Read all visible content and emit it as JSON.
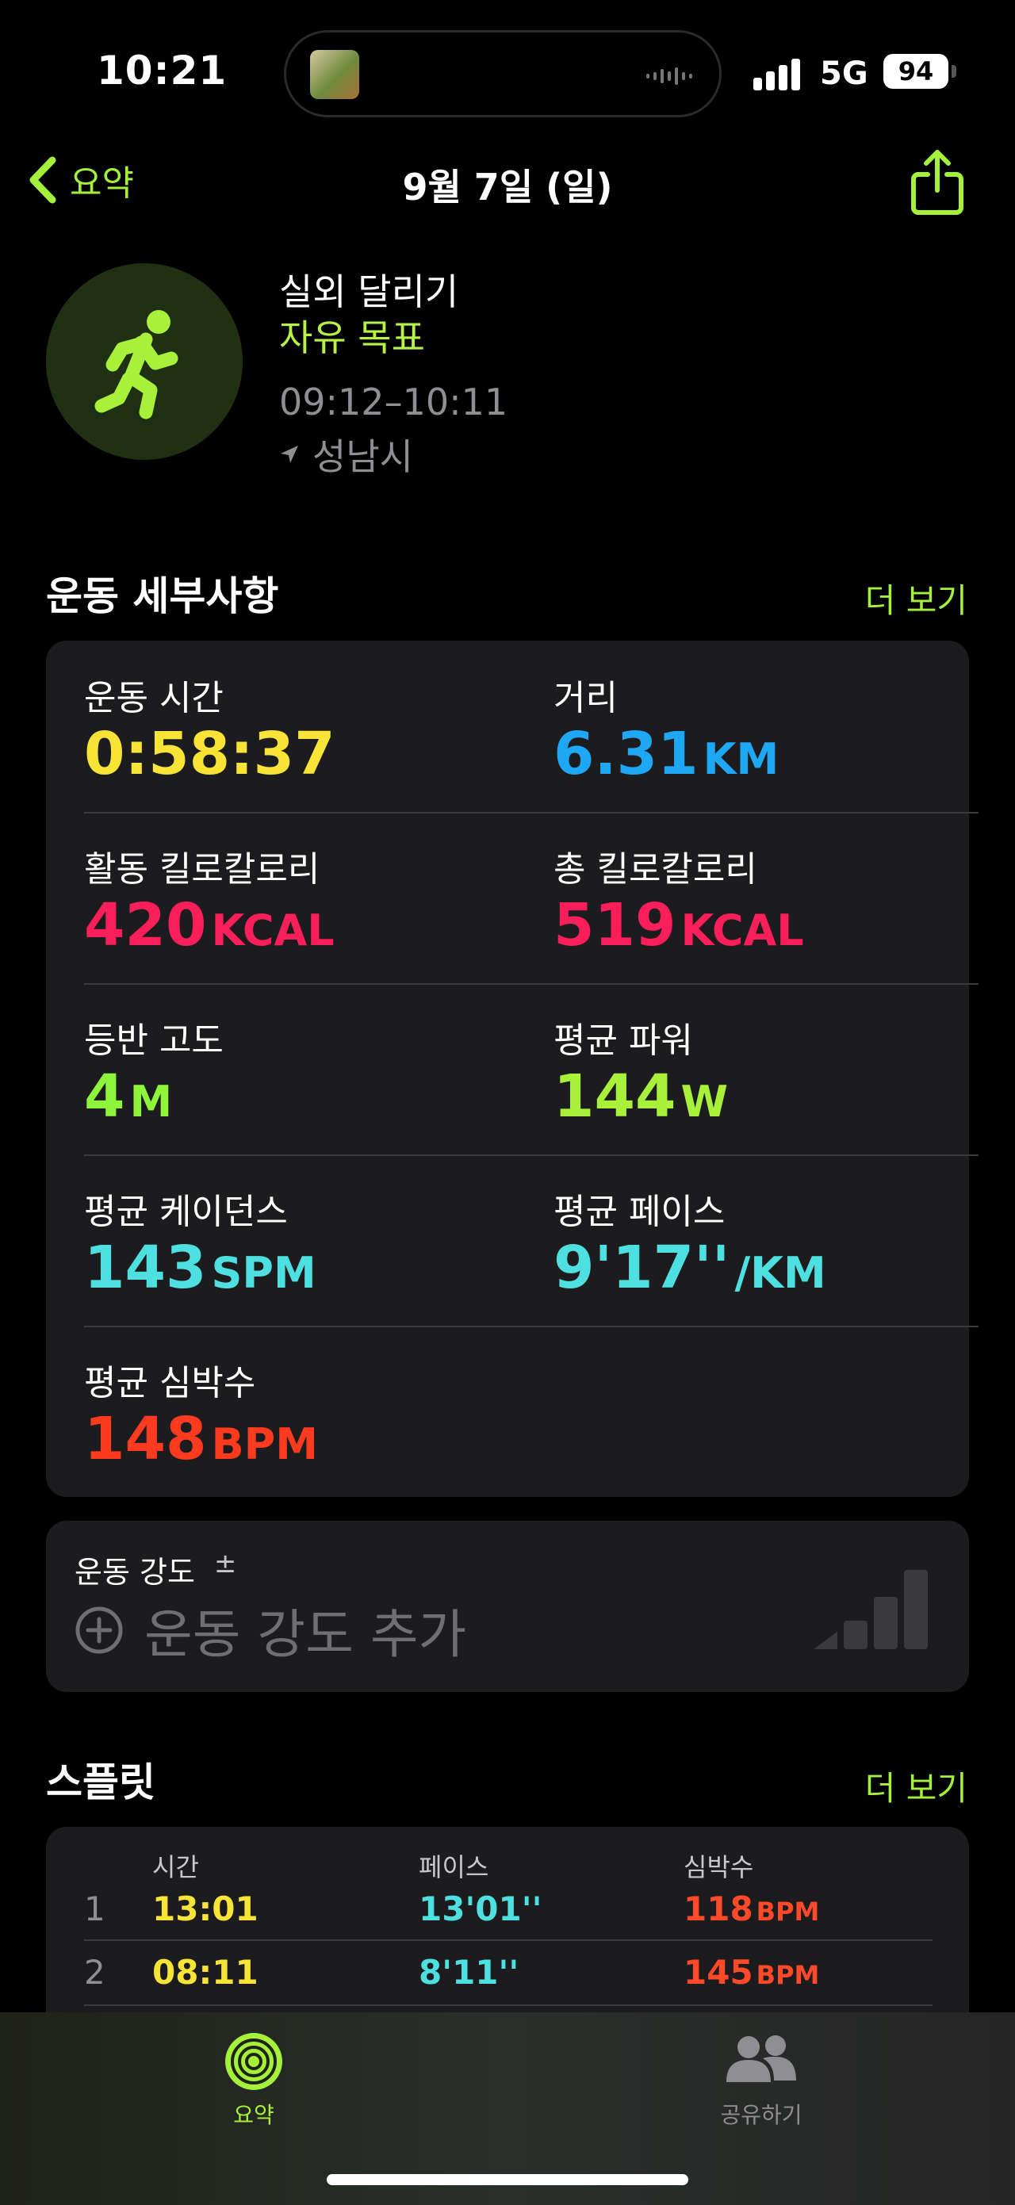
{
  "status_bar": {
    "time": "10:21",
    "network": "5G",
    "battery": "94"
  },
  "nav": {
    "back_label": "요약",
    "title": "9월 7일 (일)"
  },
  "workout": {
    "name": "실외 달리기",
    "goal": "자유 목표",
    "time_range": "09:12–10:11",
    "location": "성남시"
  },
  "details": {
    "title": "운동 세부사항",
    "more": "더 보기",
    "metrics": [
      {
        "label": "운동 시간",
        "value": "0:58:37",
        "unit": "",
        "color": "#f7e437"
      },
      {
        "label": "거리",
        "value": "6.31",
        "unit": "KM",
        "color": "#1ea7f5"
      },
      {
        "label": "활동 킬로칼로리",
        "value": "420",
        "unit": "KCAL",
        "color": "#fa1f5a"
      },
      {
        "label": "총 킬로칼로리",
        "value": "519",
        "unit": "KCAL",
        "color": "#fa1f5a"
      },
      {
        "label": "등반 고도",
        "value": "4",
        "unit": "M",
        "color": "#8ef53a"
      },
      {
        "label": "평균 파워",
        "value": "144",
        "unit": "W",
        "color": "#a8f03a"
      },
      {
        "label": "평균 케이던스",
        "value": "143",
        "unit": "SPM",
        "color": "#4ee0e0"
      },
      {
        "label": "평균 페이스",
        "value": "9'17''",
        "unit": "/KM",
        "color": "#4ee0e0"
      },
      {
        "label": "평균 심박수",
        "value": "148",
        "unit": "BPM",
        "color": "#ff3b1f"
      }
    ]
  },
  "effort": {
    "label": "운동 강도",
    "plus_minus": "±",
    "add": "운동 강도 추가"
  },
  "splits": {
    "title": "스플릿",
    "more": "더 보기",
    "headers": [
      "시간",
      "페이스",
      "심박수"
    ],
    "rows": [
      {
        "index": "1",
        "time": "13:01",
        "pace": "13'01''",
        "hr": "118",
        "hr_unit": "BPM"
      },
      {
        "index": "2",
        "time": "08:11",
        "pace": "8'11''",
        "hr": "145",
        "hr_unit": "BPM"
      }
    ],
    "colors": {
      "time": "#f7e437",
      "pace": "#4ee0e0",
      "hr": "#ff4a2a"
    }
  },
  "tabs": [
    {
      "label": "요약",
      "icon": "activity-rings-icon",
      "active": true
    },
    {
      "label": "공유하기",
      "icon": "people-icon",
      "active": false
    }
  ]
}
